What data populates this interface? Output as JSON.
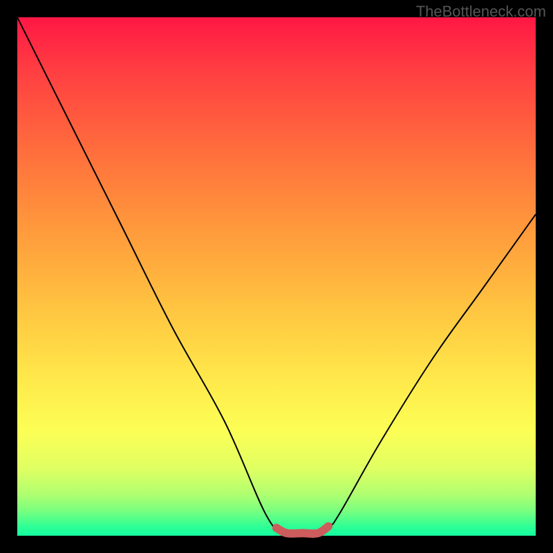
{
  "attribution": "TheBottleneck.com",
  "chart_data": {
    "type": "line",
    "title": "",
    "xlabel": "",
    "ylabel": "",
    "xlim": [
      0,
      100
    ],
    "ylim": [
      0,
      100
    ],
    "series": [
      {
        "name": "bottleneck-curve",
        "x": [
          0,
          10,
          20,
          30,
          40,
          48,
          52,
          55,
          60,
          62,
          70,
          80,
          90,
          100
        ],
        "values": [
          100,
          80,
          60,
          40,
          22,
          4,
          0,
          0,
          2,
          4,
          18,
          34,
          48,
          62
        ]
      },
      {
        "name": "optimal-range-highlight",
        "x": [
          50,
          52,
          55,
          58,
          60
        ],
        "values": [
          1.5,
          0.5,
          0.5,
          0.5,
          1.8
        ]
      }
    ],
    "highlight_color": "#cd5c5c",
    "curve_color": "#000000"
  }
}
